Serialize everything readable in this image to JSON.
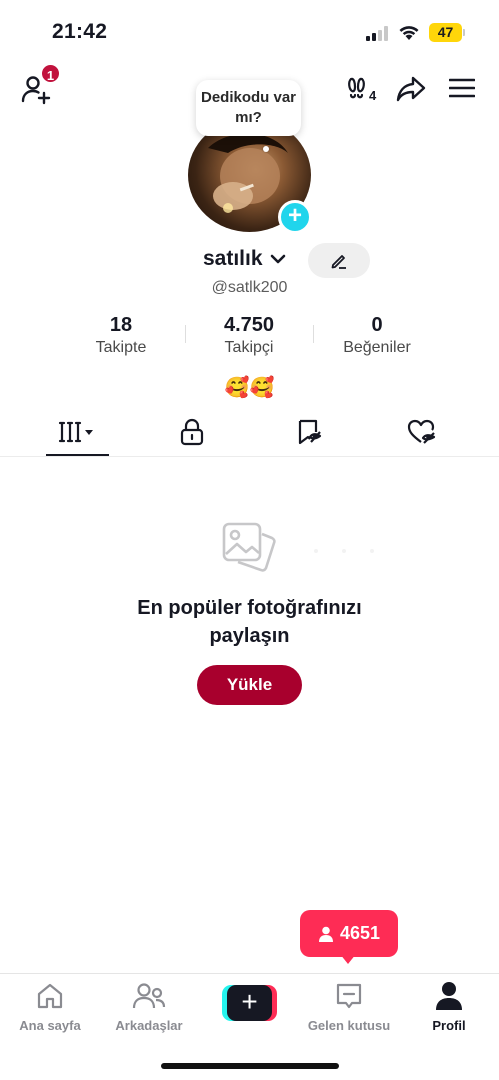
{
  "status_bar": {
    "time": "21:42",
    "battery": "47"
  },
  "header": {
    "notification_count": "1"
  },
  "profile": {
    "bubble_text": "Dedikodu var mı?",
    "name": "satılık",
    "handle": "@satlk200",
    "avatar_add": "+",
    "emoji": "🥰🥰"
  },
  "stats": [
    {
      "value": "18",
      "label": "Takipte"
    },
    {
      "value": "4.750",
      "label": "Takipçi"
    },
    {
      "value": "0",
      "label": "Beğeniler"
    }
  ],
  "tabs": [
    "videos-grid-icon",
    "lock-icon",
    "reposts-icon",
    "liked-icon"
  ],
  "empty_state": {
    "title_line1": "En popüler fotoğrafınızı",
    "title_line2": "paylaşın",
    "button_label": "Yükle"
  },
  "toast": {
    "count": "4651"
  },
  "bottom_nav": [
    {
      "label": "Ana sayfa"
    },
    {
      "label": "Arkadaşlar"
    },
    {
      "label": "+"
    },
    {
      "label": "Gelen kutusu"
    },
    {
      "label": "Profil"
    }
  ],
  "colors": {
    "accent": "#fe2c55",
    "upload_button": "#a8002d",
    "cyan": "#20d5ec",
    "battery": "#ffd60a"
  }
}
